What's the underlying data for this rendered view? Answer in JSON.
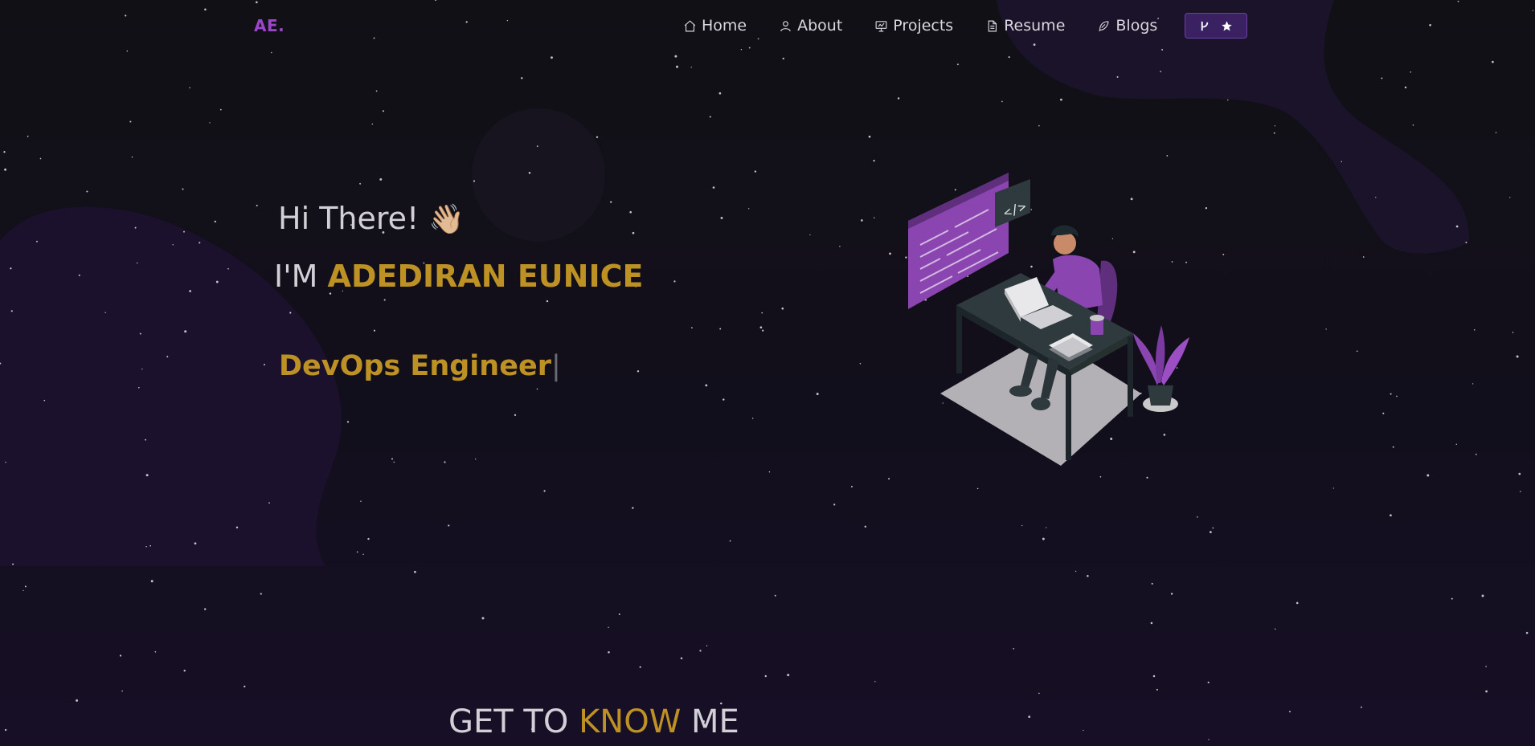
{
  "nav": {
    "logo": "AE.",
    "items": [
      {
        "label": "Home",
        "icon": "home-icon"
      },
      {
        "label": "About",
        "icon": "user-icon"
      },
      {
        "label": "Projects",
        "icon": "presentation-icon"
      },
      {
        "label": "Resume",
        "icon": "document-icon"
      },
      {
        "label": "Blogs",
        "icon": "feather-icon"
      }
    ],
    "fork_icons": [
      "git-fork-icon",
      "star-icon"
    ]
  },
  "hero": {
    "greeting": "Hi There!",
    "wave": "👋🏼",
    "name_prefix": "I'M",
    "name": "ADEDIRAN EUNICE",
    "role": "DevOps Engineer",
    "cursor": "|"
  },
  "about": {
    "heading_part1": "GET TO",
    "heading_accent": "KNOW",
    "heading_part2": "ME"
  },
  "colors": {
    "background": "#111015",
    "accent_gold": "#be9125",
    "accent_purple": "#9b45c9",
    "button_bg": "#3a2262"
  }
}
